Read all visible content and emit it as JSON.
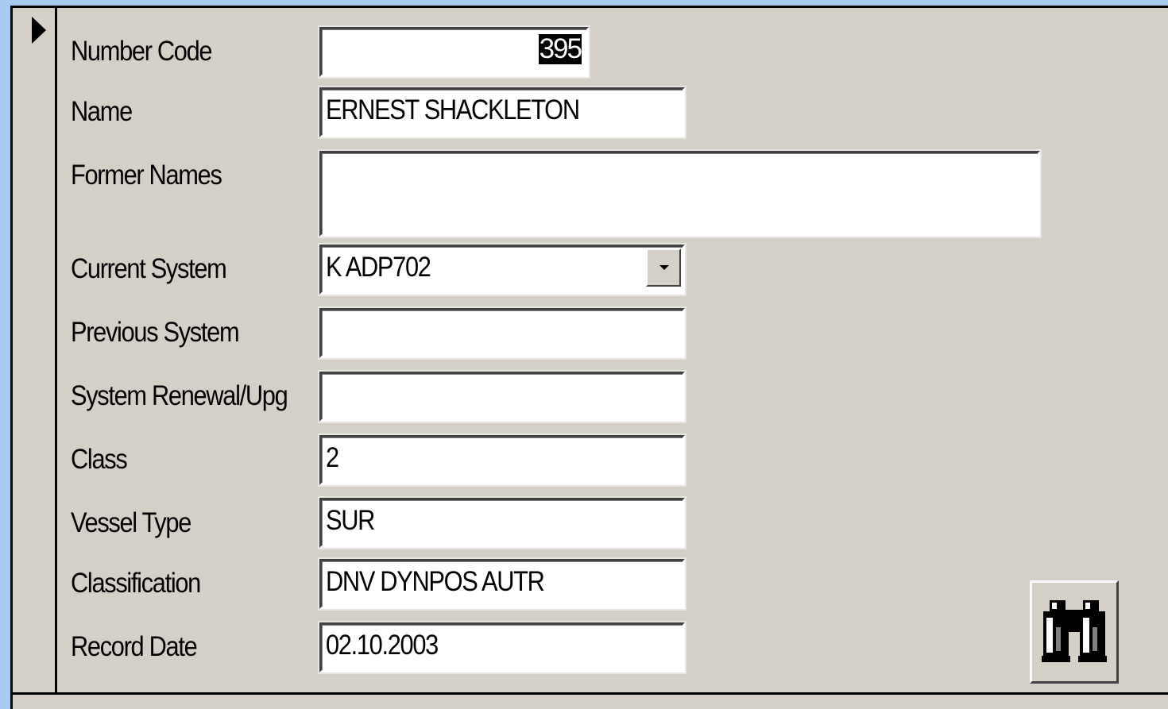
{
  "form": {
    "number_code": {
      "label": "Number Code",
      "value": "395"
    },
    "name": {
      "label": "Name",
      "value": "ERNEST SHACKLETON"
    },
    "former_names": {
      "label": "Former Names",
      "value": ""
    },
    "current_system": {
      "label": "Current System",
      "value": "K ADP702"
    },
    "previous_system": {
      "label": "Previous System",
      "value": ""
    },
    "system_renewal": {
      "label": "System Renewal/Upg",
      "value": ""
    },
    "class": {
      "label": "Class",
      "value": "2"
    },
    "vessel_type": {
      "label": "Vessel Type",
      "value": "SUR"
    },
    "classification": {
      "label": "Classification",
      "value": "DNV DYNPOS AUTR"
    },
    "record_date": {
      "label": "Record Date",
      "value": "02.10.2003"
    }
  },
  "icons": {
    "record_selector": "triangle-right-icon",
    "find_button": "binoculars-icon",
    "dropdown": "chevron-down-icon"
  },
  "colors": {
    "background": "#d4d0c8",
    "window_border": "#a6caf0",
    "field_background": "#ffffff",
    "selection": "#000000"
  }
}
